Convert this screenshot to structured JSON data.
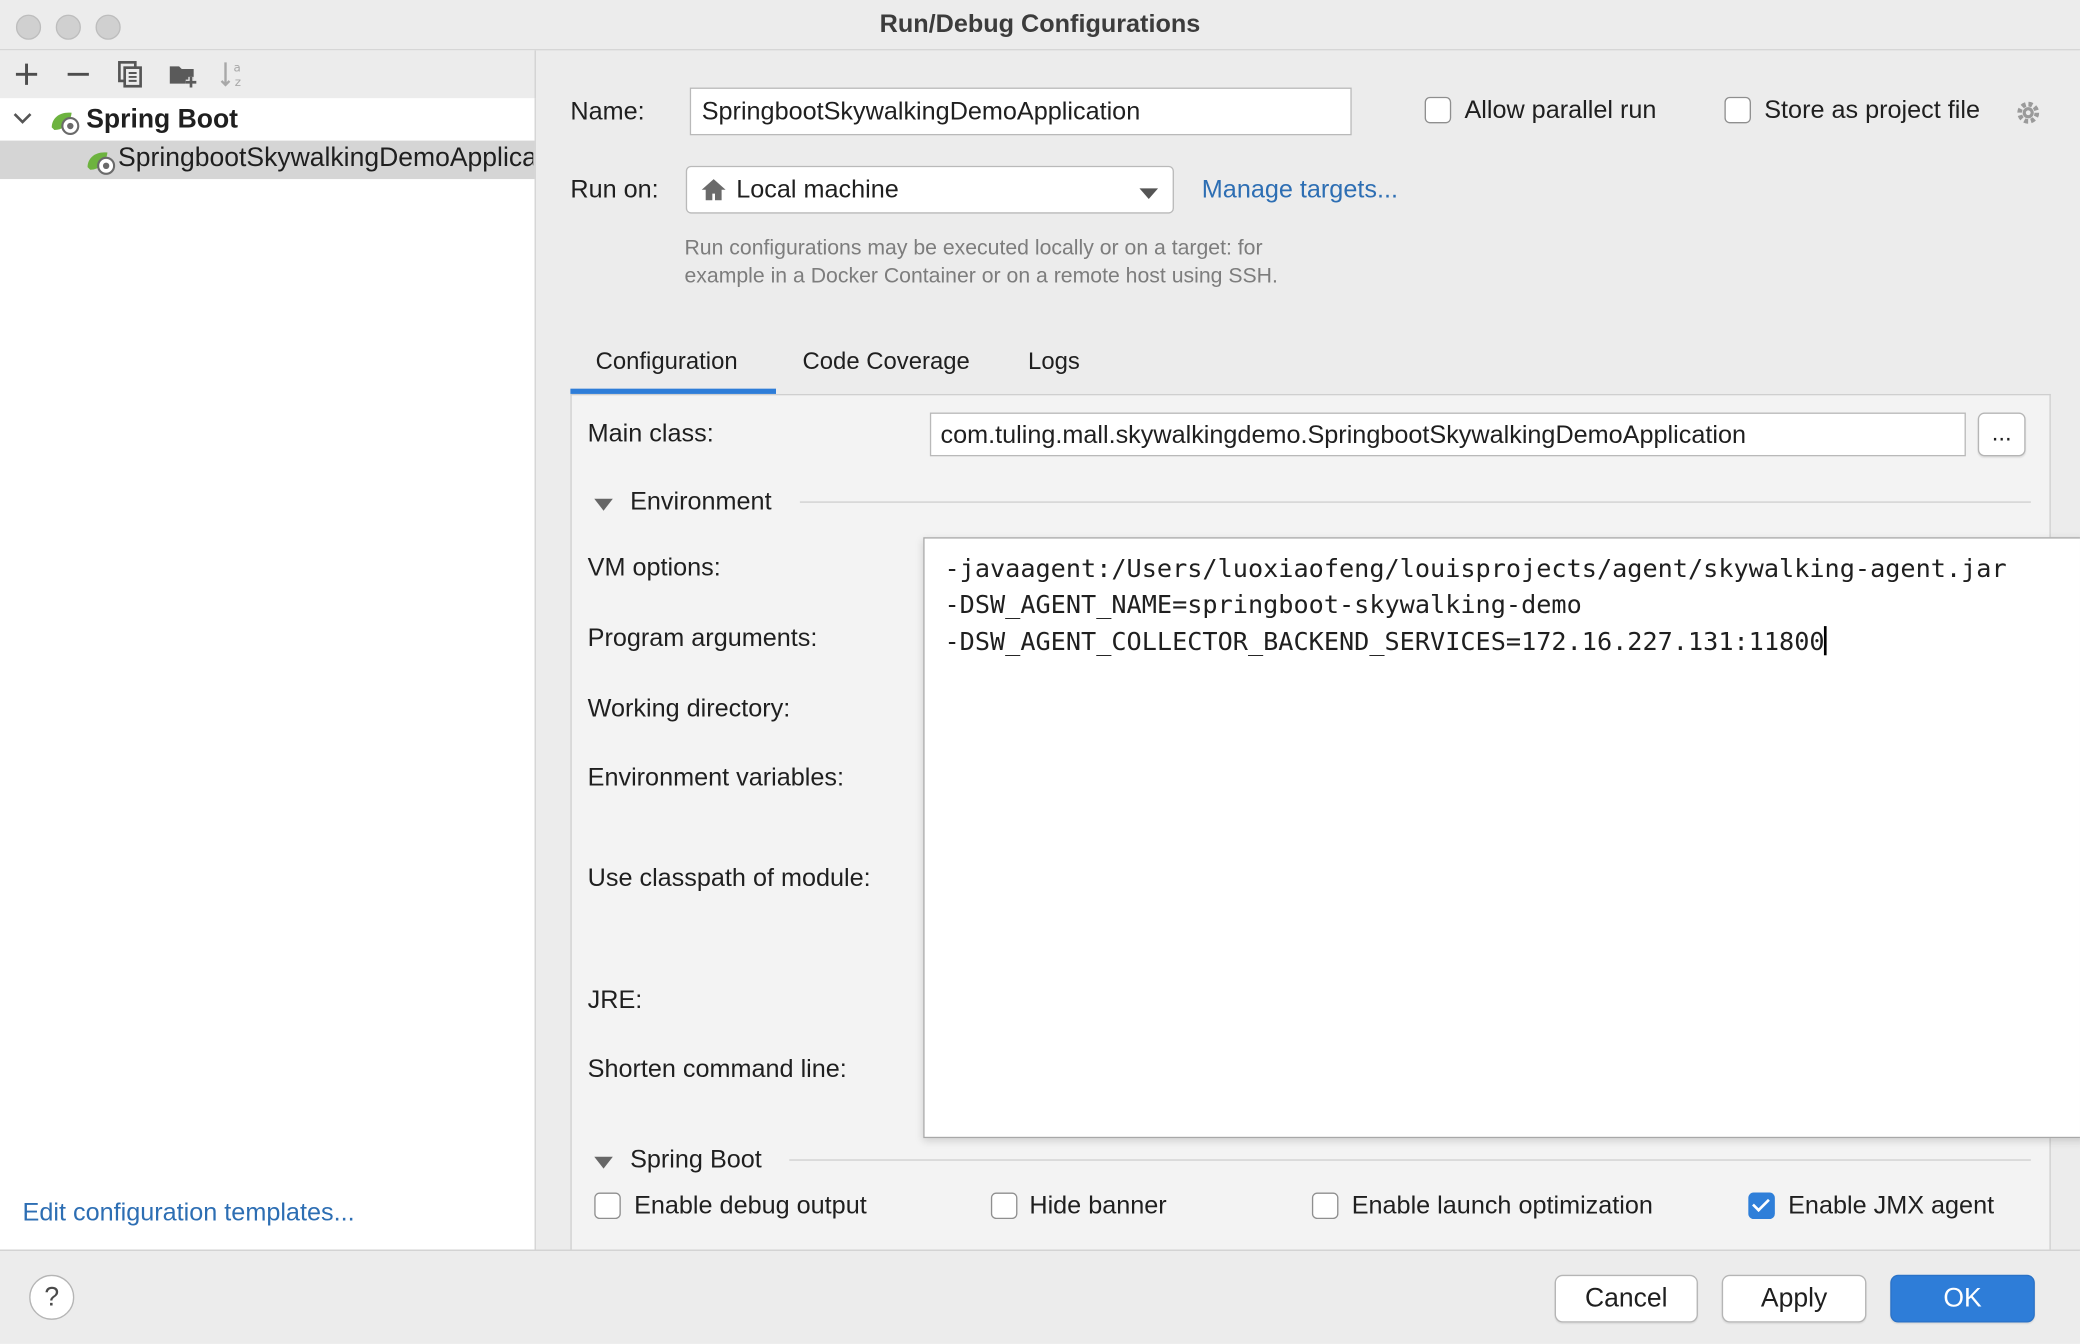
{
  "window": {
    "title": "Run/Debug Configurations"
  },
  "tree": {
    "group_label": "Spring Boot",
    "item_label": "SpringbootSkywalkingDemoApplication"
  },
  "left_footer": {
    "templates_link": "Edit configuration templates..."
  },
  "form": {
    "name_label": "Name:",
    "name_value": "SpringbootSkywalkingDemoApplication",
    "allow_parallel_label": "Allow parallel run",
    "allow_parallel_checked": false,
    "store_project_label": "Store as project file",
    "store_project_checked": false,
    "run_on_label": "Run on:",
    "run_on_value": "Local machine",
    "manage_targets": "Manage targets...",
    "hint_line1": "Run configurations may be executed locally or on a target: for",
    "hint_line2": "example in a Docker Container or on a remote host using SSH."
  },
  "tabs": [
    {
      "label": "Configuration",
      "active": true
    },
    {
      "label": "Code Coverage",
      "active": false
    },
    {
      "label": "Logs",
      "active": false
    }
  ],
  "config": {
    "main_class_label": "Main class:",
    "main_class_value": "com.tuling.mall.skywalkingdemo.SpringbootSkywalkingDemoApplication",
    "browse_label": "...",
    "environment_section": "Environment",
    "vm_options_label": "VM options:",
    "program_args_label": "Program arguments:",
    "working_dir_label": "Working directory:",
    "env_vars_label": "Environment variables:",
    "classpath_label": "Use classpath of module:",
    "jre_label": "JRE:",
    "shorten_label": "Shorten command line:",
    "vm_options_lines": [
      "-javaagent:/Users/luoxiaofeng/louisprojects/agent/skywalking-agent.jar",
      "-DSW_AGENT_NAME=springboot-skywalking-demo",
      "-DSW_AGENT_COLLECTOR_BACKEND_SERVICES=172.16.227.131:11800"
    ],
    "spring_boot_section": "Spring Boot",
    "options": [
      {
        "label": "Enable debug output",
        "checked": false
      },
      {
        "label": "Hide banner",
        "checked": false
      },
      {
        "label": "Enable launch optimization",
        "checked": false
      },
      {
        "label": "Enable JMX agent",
        "checked": true
      }
    ]
  },
  "buttons": {
    "help": "?",
    "cancel": "Cancel",
    "apply": "Apply",
    "ok": "OK"
  },
  "colors": {
    "accent": "#2e7dd8",
    "link": "#2d6eb3",
    "spring_green": "#6db33f"
  }
}
